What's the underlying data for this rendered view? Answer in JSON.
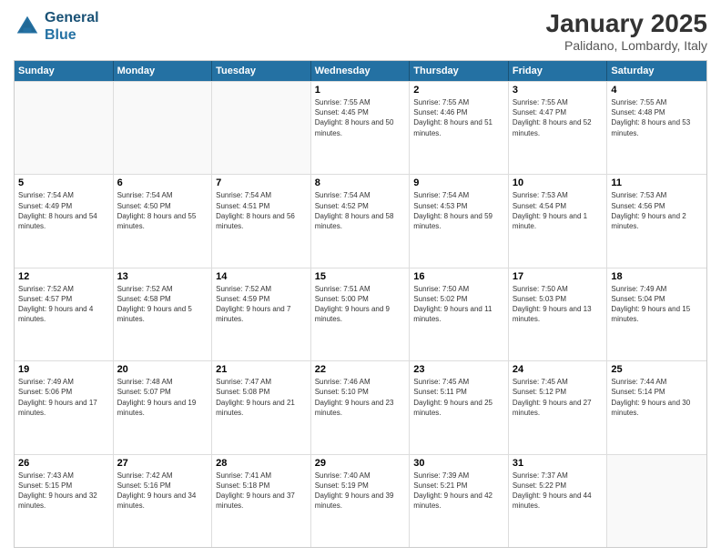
{
  "header": {
    "logo_line1": "General",
    "logo_line2": "Blue",
    "month": "January 2025",
    "location": "Palidano, Lombardy, Italy"
  },
  "days_of_week": [
    "Sunday",
    "Monday",
    "Tuesday",
    "Wednesday",
    "Thursday",
    "Friday",
    "Saturday"
  ],
  "weeks": [
    [
      {
        "day": "",
        "sunrise": "",
        "sunset": "",
        "daylight": "",
        "empty": true
      },
      {
        "day": "",
        "sunrise": "",
        "sunset": "",
        "daylight": "",
        "empty": true
      },
      {
        "day": "",
        "sunrise": "",
        "sunset": "",
        "daylight": "",
        "empty": true
      },
      {
        "day": "1",
        "sunrise": "Sunrise: 7:55 AM",
        "sunset": "Sunset: 4:45 PM",
        "daylight": "Daylight: 8 hours and 50 minutes.",
        "empty": false
      },
      {
        "day": "2",
        "sunrise": "Sunrise: 7:55 AM",
        "sunset": "Sunset: 4:46 PM",
        "daylight": "Daylight: 8 hours and 51 minutes.",
        "empty": false
      },
      {
        "day": "3",
        "sunrise": "Sunrise: 7:55 AM",
        "sunset": "Sunset: 4:47 PM",
        "daylight": "Daylight: 8 hours and 52 minutes.",
        "empty": false
      },
      {
        "day": "4",
        "sunrise": "Sunrise: 7:55 AM",
        "sunset": "Sunset: 4:48 PM",
        "daylight": "Daylight: 8 hours and 53 minutes.",
        "empty": false
      }
    ],
    [
      {
        "day": "5",
        "sunrise": "Sunrise: 7:54 AM",
        "sunset": "Sunset: 4:49 PM",
        "daylight": "Daylight: 8 hours and 54 minutes.",
        "empty": false
      },
      {
        "day": "6",
        "sunrise": "Sunrise: 7:54 AM",
        "sunset": "Sunset: 4:50 PM",
        "daylight": "Daylight: 8 hours and 55 minutes.",
        "empty": false
      },
      {
        "day": "7",
        "sunrise": "Sunrise: 7:54 AM",
        "sunset": "Sunset: 4:51 PM",
        "daylight": "Daylight: 8 hours and 56 minutes.",
        "empty": false
      },
      {
        "day": "8",
        "sunrise": "Sunrise: 7:54 AM",
        "sunset": "Sunset: 4:52 PM",
        "daylight": "Daylight: 8 hours and 58 minutes.",
        "empty": false
      },
      {
        "day": "9",
        "sunrise": "Sunrise: 7:54 AM",
        "sunset": "Sunset: 4:53 PM",
        "daylight": "Daylight: 8 hours and 59 minutes.",
        "empty": false
      },
      {
        "day": "10",
        "sunrise": "Sunrise: 7:53 AM",
        "sunset": "Sunset: 4:54 PM",
        "daylight": "Daylight: 9 hours and 1 minute.",
        "empty": false
      },
      {
        "day": "11",
        "sunrise": "Sunrise: 7:53 AM",
        "sunset": "Sunset: 4:56 PM",
        "daylight": "Daylight: 9 hours and 2 minutes.",
        "empty": false
      }
    ],
    [
      {
        "day": "12",
        "sunrise": "Sunrise: 7:52 AM",
        "sunset": "Sunset: 4:57 PM",
        "daylight": "Daylight: 9 hours and 4 minutes.",
        "empty": false
      },
      {
        "day": "13",
        "sunrise": "Sunrise: 7:52 AM",
        "sunset": "Sunset: 4:58 PM",
        "daylight": "Daylight: 9 hours and 5 minutes.",
        "empty": false
      },
      {
        "day": "14",
        "sunrise": "Sunrise: 7:52 AM",
        "sunset": "Sunset: 4:59 PM",
        "daylight": "Daylight: 9 hours and 7 minutes.",
        "empty": false
      },
      {
        "day": "15",
        "sunrise": "Sunrise: 7:51 AM",
        "sunset": "Sunset: 5:00 PM",
        "daylight": "Daylight: 9 hours and 9 minutes.",
        "empty": false
      },
      {
        "day": "16",
        "sunrise": "Sunrise: 7:50 AM",
        "sunset": "Sunset: 5:02 PM",
        "daylight": "Daylight: 9 hours and 11 minutes.",
        "empty": false
      },
      {
        "day": "17",
        "sunrise": "Sunrise: 7:50 AM",
        "sunset": "Sunset: 5:03 PM",
        "daylight": "Daylight: 9 hours and 13 minutes.",
        "empty": false
      },
      {
        "day": "18",
        "sunrise": "Sunrise: 7:49 AM",
        "sunset": "Sunset: 5:04 PM",
        "daylight": "Daylight: 9 hours and 15 minutes.",
        "empty": false
      }
    ],
    [
      {
        "day": "19",
        "sunrise": "Sunrise: 7:49 AM",
        "sunset": "Sunset: 5:06 PM",
        "daylight": "Daylight: 9 hours and 17 minutes.",
        "empty": false
      },
      {
        "day": "20",
        "sunrise": "Sunrise: 7:48 AM",
        "sunset": "Sunset: 5:07 PM",
        "daylight": "Daylight: 9 hours and 19 minutes.",
        "empty": false
      },
      {
        "day": "21",
        "sunrise": "Sunrise: 7:47 AM",
        "sunset": "Sunset: 5:08 PM",
        "daylight": "Daylight: 9 hours and 21 minutes.",
        "empty": false
      },
      {
        "day": "22",
        "sunrise": "Sunrise: 7:46 AM",
        "sunset": "Sunset: 5:10 PM",
        "daylight": "Daylight: 9 hours and 23 minutes.",
        "empty": false
      },
      {
        "day": "23",
        "sunrise": "Sunrise: 7:45 AM",
        "sunset": "Sunset: 5:11 PM",
        "daylight": "Daylight: 9 hours and 25 minutes.",
        "empty": false
      },
      {
        "day": "24",
        "sunrise": "Sunrise: 7:45 AM",
        "sunset": "Sunset: 5:12 PM",
        "daylight": "Daylight: 9 hours and 27 minutes.",
        "empty": false
      },
      {
        "day": "25",
        "sunrise": "Sunrise: 7:44 AM",
        "sunset": "Sunset: 5:14 PM",
        "daylight": "Daylight: 9 hours and 30 minutes.",
        "empty": false
      }
    ],
    [
      {
        "day": "26",
        "sunrise": "Sunrise: 7:43 AM",
        "sunset": "Sunset: 5:15 PM",
        "daylight": "Daylight: 9 hours and 32 minutes.",
        "empty": false
      },
      {
        "day": "27",
        "sunrise": "Sunrise: 7:42 AM",
        "sunset": "Sunset: 5:16 PM",
        "daylight": "Daylight: 9 hours and 34 minutes.",
        "empty": false
      },
      {
        "day": "28",
        "sunrise": "Sunrise: 7:41 AM",
        "sunset": "Sunset: 5:18 PM",
        "daylight": "Daylight: 9 hours and 37 minutes.",
        "empty": false
      },
      {
        "day": "29",
        "sunrise": "Sunrise: 7:40 AM",
        "sunset": "Sunset: 5:19 PM",
        "daylight": "Daylight: 9 hours and 39 minutes.",
        "empty": false
      },
      {
        "day": "30",
        "sunrise": "Sunrise: 7:39 AM",
        "sunset": "Sunset: 5:21 PM",
        "daylight": "Daylight: 9 hours and 42 minutes.",
        "empty": false
      },
      {
        "day": "31",
        "sunrise": "Sunrise: 7:37 AM",
        "sunset": "Sunset: 5:22 PM",
        "daylight": "Daylight: 9 hours and 44 minutes.",
        "empty": false
      },
      {
        "day": "",
        "sunrise": "",
        "sunset": "",
        "daylight": "",
        "empty": true
      }
    ]
  ]
}
